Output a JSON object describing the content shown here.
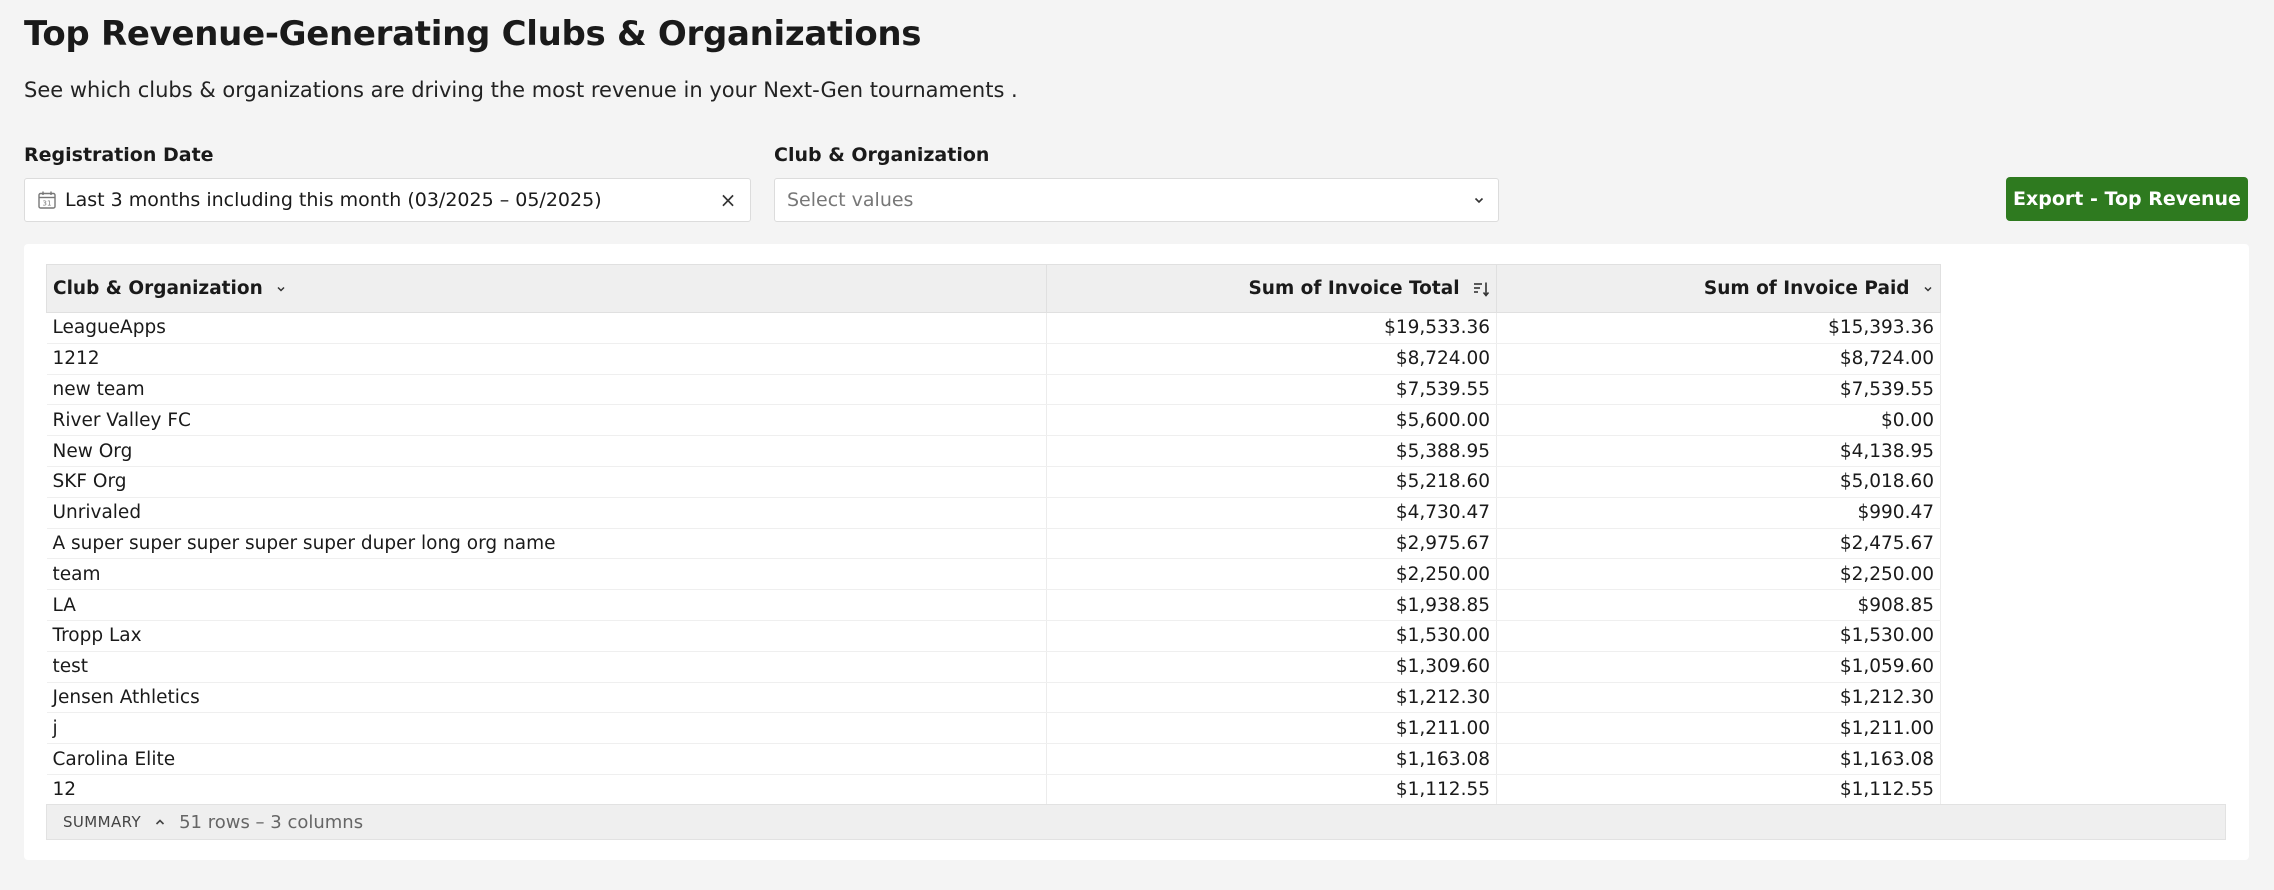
{
  "page": {
    "title": "Top Revenue-Generating Clubs & Organizations",
    "subtitle": "See which clubs & organizations are driving the most revenue in your Next-Gen tournaments ."
  },
  "filters": {
    "registration_date": {
      "label": "Registration Date",
      "value": "Last 3 months including this month (03/2025 – 05/2025)",
      "icon": "calendar-icon",
      "clear_icon": "close-icon",
      "clear_glyph": "×"
    },
    "club_org": {
      "label": "Club & Organization",
      "placeholder": "Select values",
      "icon": "chevron-down-icon"
    }
  },
  "export_button": {
    "label": "Export - Top Revenue",
    "color": "#2e7a1f"
  },
  "table": {
    "columns": [
      {
        "label": "Club & Organization",
        "icon": "chevron-down-icon"
      },
      {
        "label": "Sum of Invoice Total",
        "icon": "sort-descending-icon"
      },
      {
        "label": "Sum of Invoice Paid",
        "icon": "chevron-down-icon"
      }
    ],
    "rows": [
      [
        "LeagueApps",
        "$19,533.36",
        "$15,393.36"
      ],
      [
        "1212",
        "$8,724.00",
        "$8,724.00"
      ],
      [
        "new team",
        "$7,539.55",
        "$7,539.55"
      ],
      [
        "River Valley FC",
        "$5,600.00",
        "$0.00"
      ],
      [
        "New Org",
        "$5,388.95",
        "$4,138.95"
      ],
      [
        "SKF Org",
        "$5,218.60",
        "$5,018.60"
      ],
      [
        "Unrivaled",
        "$4,730.47",
        "$990.47"
      ],
      [
        "A super super super super super duper long org name",
        "$2,975.67",
        "$2,475.67"
      ],
      [
        "team",
        "$2,250.00",
        "$2,250.00"
      ],
      [
        "LA",
        "$1,938.85",
        "$908.85"
      ],
      [
        "Tropp Lax",
        "$1,530.00",
        "$1,530.00"
      ],
      [
        "test",
        "$1,309.60",
        "$1,059.60"
      ],
      [
        "Jensen Athletics",
        "$1,212.30",
        "$1,212.30"
      ],
      [
        "j",
        "$1,211.00",
        "$1,211.00"
      ],
      [
        "Carolina Elite",
        "$1,163.08",
        "$1,163.08"
      ],
      [
        "12",
        "$1,112.55",
        "$1,112.55"
      ]
    ]
  },
  "summary": {
    "label": "SUMMARY",
    "icon": "chevron-up-icon",
    "count": "51 rows – 3 columns"
  }
}
